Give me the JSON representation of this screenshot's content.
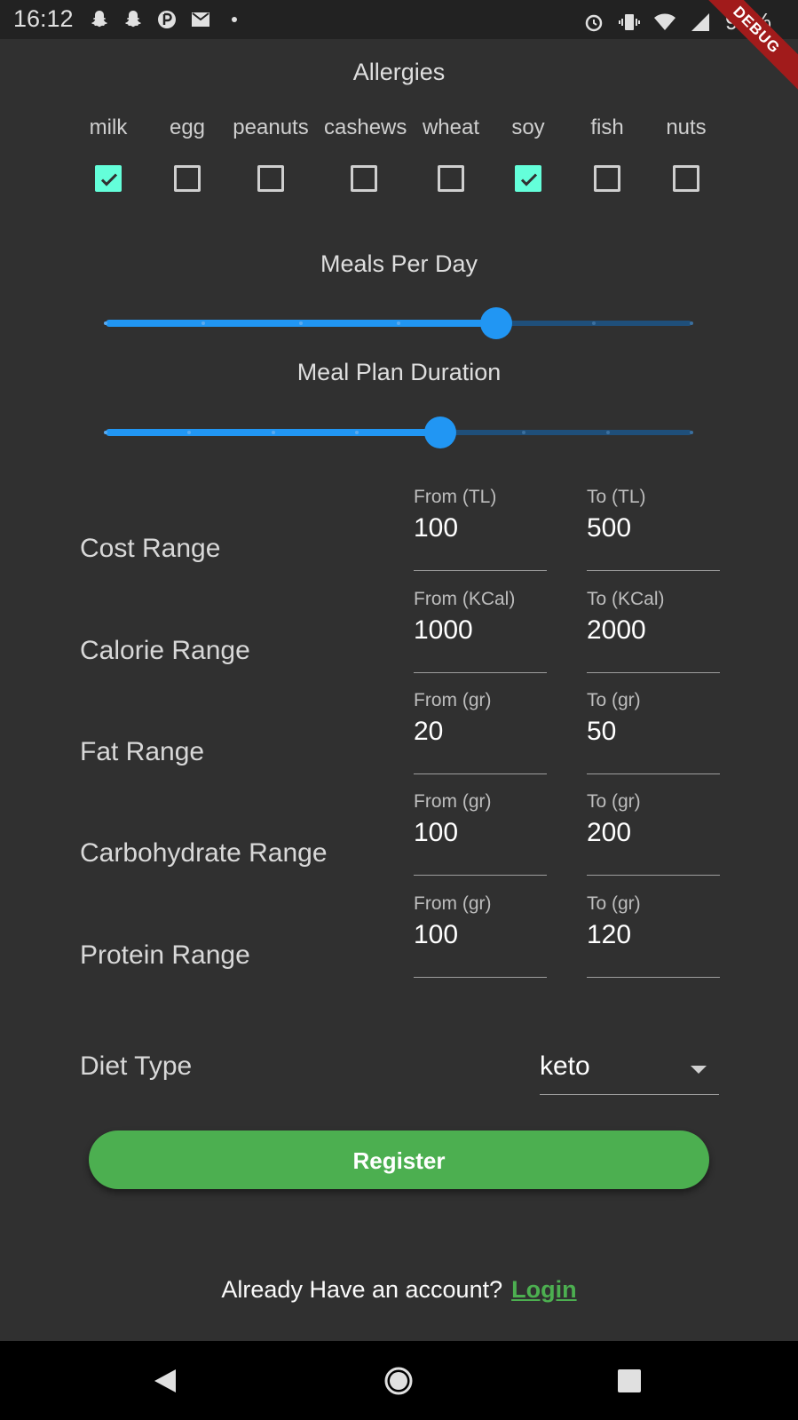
{
  "status_bar": {
    "time": "16:12",
    "battery_text": "94%",
    "left_icons": [
      "snapchat-icon",
      "snapchat-icon",
      "app-icon",
      "mail-icon",
      "dot-icon"
    ],
    "right_icons": [
      "alarm-icon",
      "vibrate-icon",
      "wifi-icon",
      "signal-icon",
      "battery-icon"
    ]
  },
  "debug_banner": "DEBUG",
  "allergies": {
    "title": "Allergies",
    "items": [
      {
        "label": "milk",
        "checked": true
      },
      {
        "label": "egg",
        "checked": false
      },
      {
        "label": "peanuts",
        "checked": false
      },
      {
        "label": "cashews",
        "checked": false
      },
      {
        "label": "wheat",
        "checked": false
      },
      {
        "label": "soy",
        "checked": true
      },
      {
        "label": "fish",
        "checked": false
      },
      {
        "label": "nuts",
        "checked": false
      }
    ]
  },
  "meals_per_day": {
    "title": "Meals Per Day",
    "value_fraction": 0.667,
    "divisions": 6
  },
  "meal_plan_duration": {
    "title": "Meal Plan Duration",
    "value_fraction": 0.571,
    "divisions": 7
  },
  "ranges": [
    {
      "label": "Cost Range",
      "from_label": "From (TL)",
      "from_value": "100",
      "to_label": "To (TL)",
      "to_value": "500"
    },
    {
      "label": "Calorie Range",
      "from_label": "From (KCal)",
      "from_value": "1000",
      "to_label": "To (KCal)",
      "to_value": "2000"
    },
    {
      "label": "Fat Range",
      "from_label": "From (gr)",
      "from_value": "20",
      "to_label": "To (gr)",
      "to_value": "50"
    },
    {
      "label": "Carbohydrate Range",
      "from_label": "From (gr)",
      "from_value": "100",
      "to_label": "To (gr)",
      "to_value": "200"
    },
    {
      "label": "Protein Range",
      "from_label": "From (gr)",
      "from_value": "100",
      "to_label": "To (gr)",
      "to_value": "120"
    }
  ],
  "diet_type": {
    "label": "Diet Type",
    "value": "keto"
  },
  "register_label": "Register",
  "footer": {
    "text": "Already Have an account?",
    "link": "Login"
  },
  "colors": {
    "background": "#303030",
    "checkbox_checked": "#64ffda",
    "slider_active": "#2196f3",
    "button": "#4caf50",
    "link": "#4caf50"
  },
  "nav_icons": [
    "back-icon",
    "home-icon",
    "recents-icon"
  ]
}
